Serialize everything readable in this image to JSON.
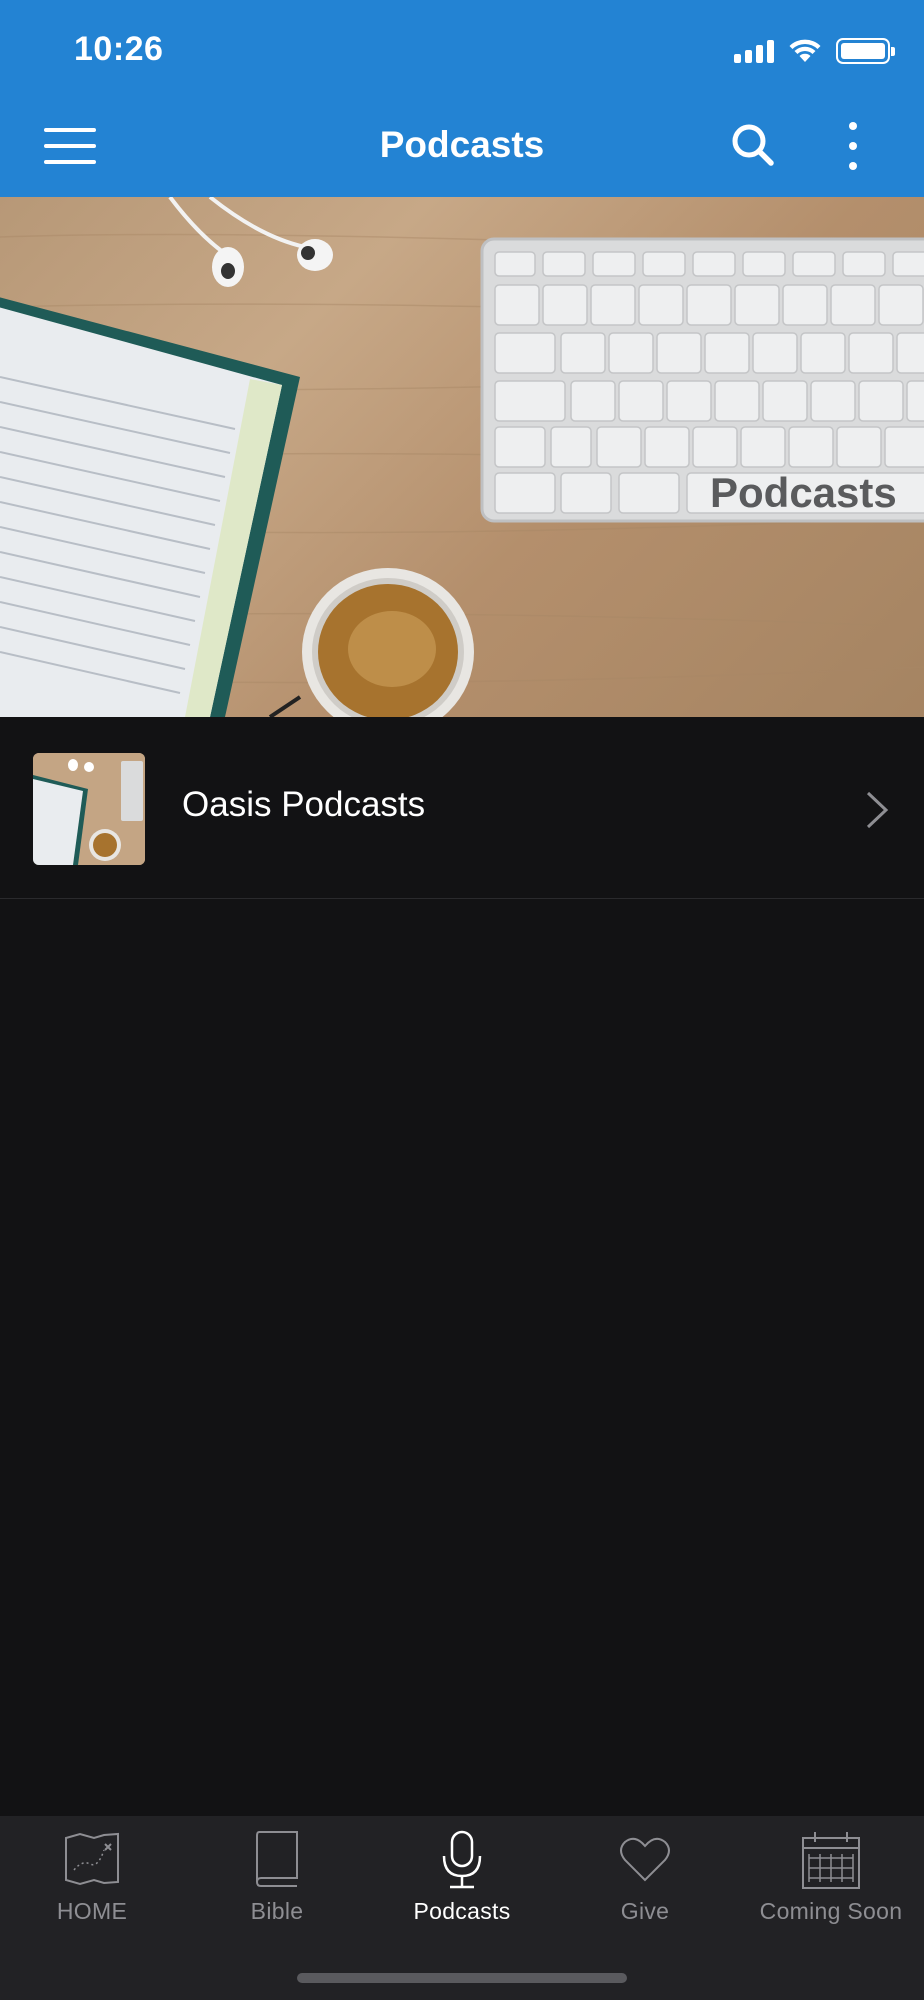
{
  "status_bar": {
    "time": "10:26",
    "icons": [
      "cellular-signal-icon",
      "wifi-icon",
      "battery-icon"
    ]
  },
  "nav_bar": {
    "title": "Podcasts",
    "icons": [
      "hamburger-menu-icon",
      "search-icon",
      "more-vertical-icon"
    ],
    "background_color": "#2383d3"
  },
  "hero": {
    "overlay_text": "Podcasts"
  },
  "list": {
    "items": [
      {
        "label": "Oasis Podcasts",
        "icon": "chevron-right-icon"
      }
    ]
  },
  "tab_bar": {
    "items": [
      {
        "label": "HOME",
        "icon": "map-icon"
      },
      {
        "label": "Bible",
        "icon": "book-icon"
      },
      {
        "label": "Podcasts",
        "icon": "microphone-icon",
        "active": true
      },
      {
        "label": "Give",
        "icon": "heart-icon"
      },
      {
        "label": "Coming Soon",
        "icon": "calendar-icon"
      }
    ]
  },
  "colors": {
    "accent": "#2383d3",
    "background": "#121214",
    "tab_bar": "#222225",
    "inactive_tab": "#8e8e93"
  }
}
